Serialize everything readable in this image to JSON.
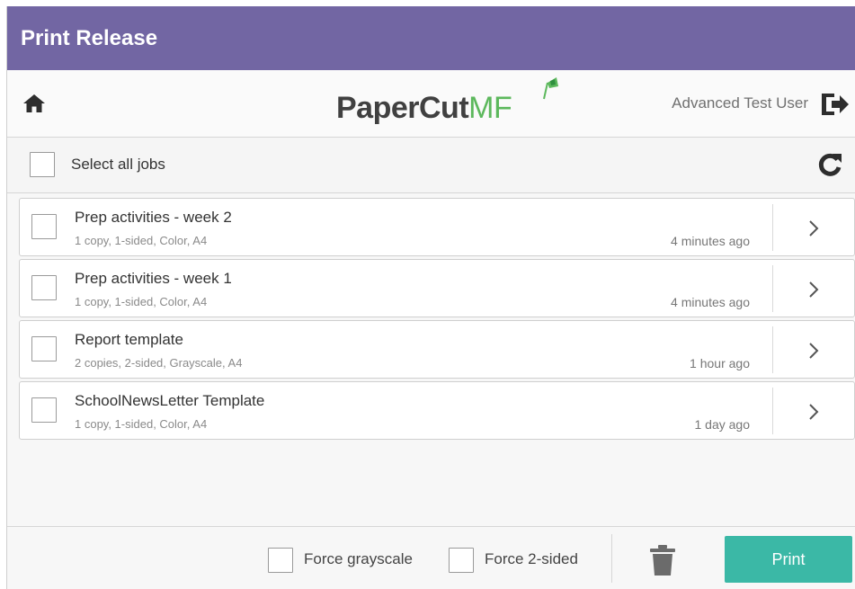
{
  "titlebar": {
    "title": "Print Release"
  },
  "header": {
    "logo_paper": "PaperCut",
    "logo_mf": "MF",
    "username": "Advanced Test User"
  },
  "selectbar": {
    "label": "Select all jobs"
  },
  "jobs": [
    {
      "name": "Prep activities - week 2",
      "meta": "1 copy, 1-sided, Color, A4",
      "time": "4 minutes ago"
    },
    {
      "name": "Prep activities - week 1",
      "meta": "1 copy, 1-sided, Color, A4",
      "time": "4 minutes ago"
    },
    {
      "name": "Report template",
      "meta": "2 copies, 2-sided, Grayscale, A4",
      "time": "1 hour ago"
    },
    {
      "name": "SchoolNewsLetter Template",
      "meta": "1 copy, 1-sided, Color, A4",
      "time": "1 day ago"
    }
  ],
  "footer": {
    "force_grayscale": "Force grayscale",
    "force_2sided": "Force 2-sided",
    "print_label": "Print"
  },
  "icons": {
    "home": "home-icon",
    "logout": "logout-icon",
    "refresh": "refresh-icon",
    "chevron": "chevron-right-icon",
    "trash": "trash-icon"
  },
  "colors": {
    "titlebar": "#7266a3",
    "brand_green": "#5cb85c",
    "print_button": "#3bb8a6"
  }
}
